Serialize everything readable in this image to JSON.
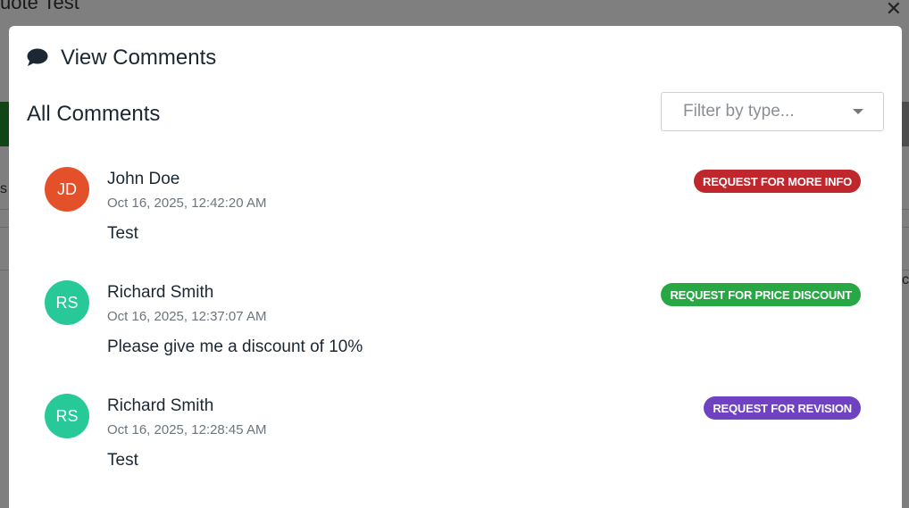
{
  "background": {
    "title_fragment": "uote Test",
    "left_fragment": "s",
    "right_fragment": "c"
  },
  "modal": {
    "close_symbol": "✕",
    "title": "View Comments",
    "section_title": "All Comments",
    "filter": {
      "placeholder": "Filter by type..."
    }
  },
  "comments": [
    {
      "initials": "JD",
      "avatar_color": "#e4502a",
      "author": "John Doe",
      "timestamp": "Oct 16, 2025, 12:42:20 AM",
      "text": "Test",
      "badge": "REQUEST FOR MORE INFO",
      "badge_color": "#c0272d"
    },
    {
      "initials": "RS",
      "avatar_color": "#26c997",
      "author": "Richard Smith",
      "timestamp": "Oct 16, 2025, 12:37:07 AM",
      "text": "Please give me a discount of 10%",
      "badge": "REQUEST FOR PRICE DISCOUNT",
      "badge_color": "#28a745"
    },
    {
      "initials": "RS",
      "avatar_color": "#26c997",
      "author": "Richard Smith",
      "timestamp": "Oct 16, 2025, 12:28:45 AM",
      "text": "Test",
      "badge": "REQUEST FOR REVISION",
      "badge_color": "#6f42c1"
    }
  ],
  "colors": {
    "title_text": "#1b2733",
    "overlay": "rgba(0,0,0,0.5)"
  }
}
